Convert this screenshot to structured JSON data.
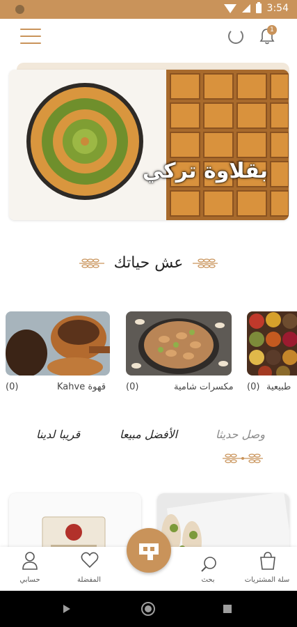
{
  "status_bar": {
    "time": "3:54"
  },
  "header": {
    "notification_count": "1"
  },
  "banner": {
    "title": "بقلاوة تركي"
  },
  "section": {
    "title": "عش حياتك"
  },
  "categories": [
    {
      "label": "قهوة Kahve",
      "count": "(0)"
    },
    {
      "label": "مكسرات شامية",
      "count": "(0)"
    },
    {
      "label": "طبيعية",
      "count": "(0)"
    }
  ],
  "product_tabs": [
    {
      "label": "قريبا لدينا"
    },
    {
      "label": "الأفضل مبيعا"
    },
    {
      "label": "وصل حديثا"
    }
  ],
  "bottom_nav": {
    "account": "حسابي",
    "favorites": "المفضلة",
    "search": "بحث",
    "cart": "سلة المشتريات"
  },
  "colors": {
    "accent": "#c9935a",
    "status_bar": "#c9935a",
    "text_dark": "#222222",
    "tab_inactive": "#8a8a8a"
  }
}
